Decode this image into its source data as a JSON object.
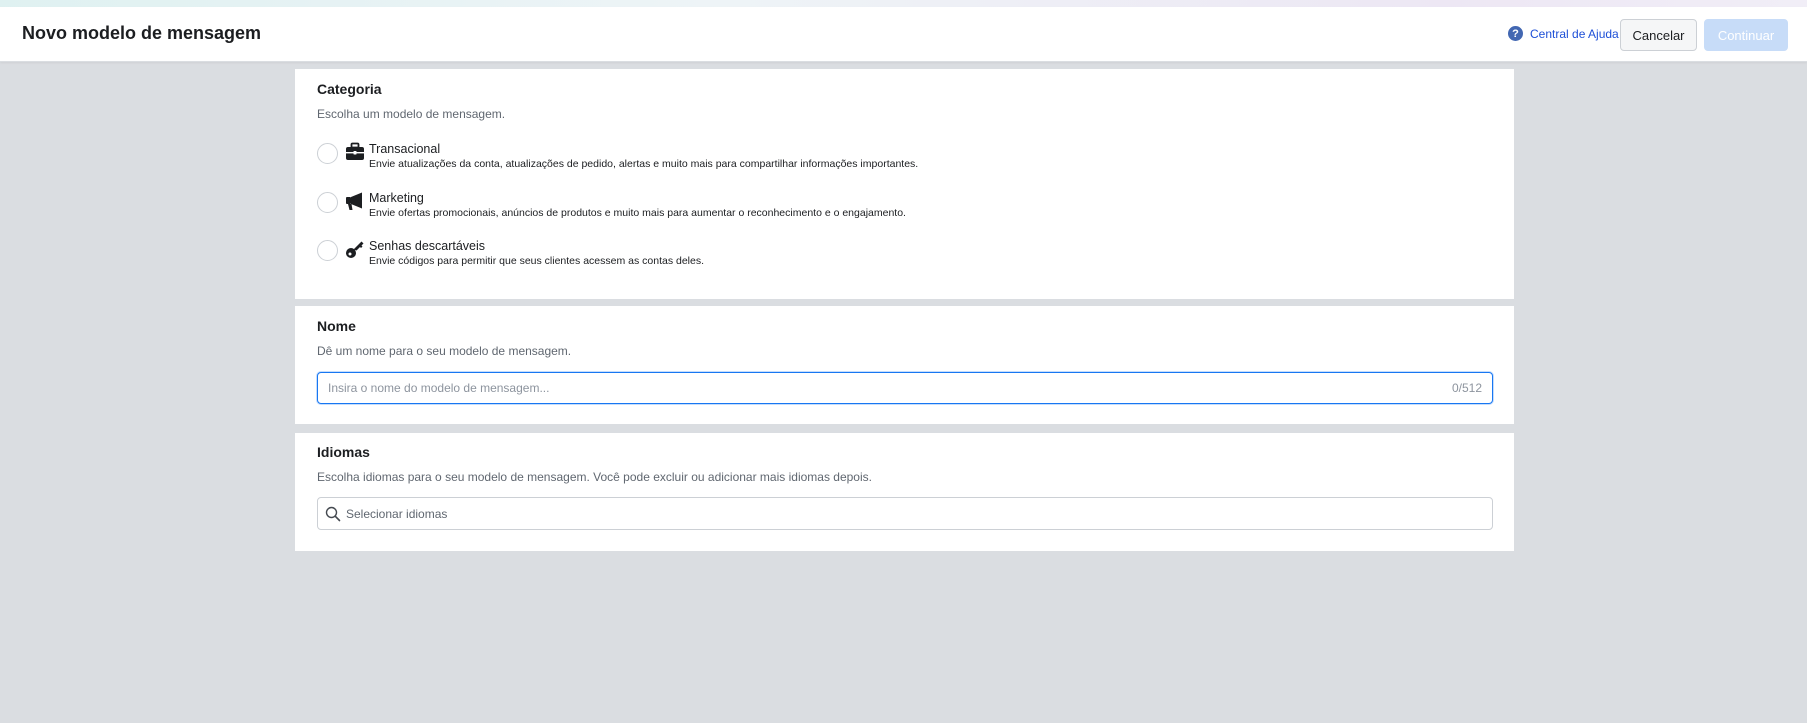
{
  "header": {
    "title": "Novo modelo de mensagem",
    "help_label": "Central de Ajuda",
    "cancel_label": "Cancelar",
    "continue_label": "Continuar",
    "continue_enabled": false
  },
  "category": {
    "title": "Categoria",
    "description": "Escolha um modelo de mensagem.",
    "options": [
      {
        "label": "Transacional",
        "description": "Envie atualizações da conta, atualizações de pedido, alertas e muito mais para compartilhar informações importantes.",
        "icon": "briefcase-icon",
        "selected": false
      },
      {
        "label": "Marketing",
        "description": "Envie ofertas promocionais, anúncios de produtos e muito mais para aumentar o reconhecimento e o engajamento.",
        "icon": "megaphone-icon",
        "selected": false
      },
      {
        "label": "Senhas descartáveis",
        "description": "Envie códigos para permitir que seus clientes acessem as contas deles.",
        "icon": "key-icon",
        "selected": false
      }
    ]
  },
  "name": {
    "title": "Nome",
    "description": "Dê um nome para o seu modelo de mensagem.",
    "input_placeholder": "Insira o nome do modelo de mensagem...",
    "input_value": "",
    "counter": "0/512"
  },
  "languages": {
    "title": "Idiomas",
    "description": "Escolha idiomas para o seu modelo de mensagem. Você pode excluir ou adicionar mais idiomas depois.",
    "search_placeholder": "Selecionar idiomas"
  },
  "colors": {
    "accent": "#1877f2",
    "help_link": "#1d4fd7",
    "page_background": "#dadde1",
    "continue_disabled": "#c7dcf8"
  }
}
